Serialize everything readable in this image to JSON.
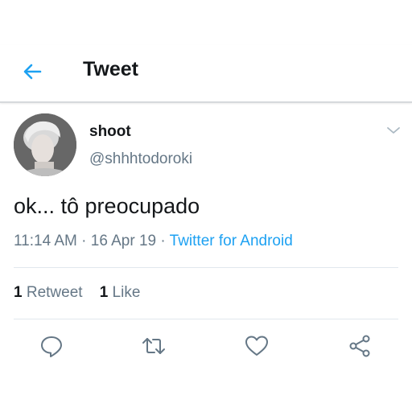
{
  "header": {
    "back_icon": "back-arrow-icon",
    "title": "Tweet"
  },
  "tweet": {
    "author": {
      "display_name": "shoot",
      "handle": "@shhhtodoroki"
    },
    "text": "ok... tô preocupado",
    "time": "11:14 AM",
    "separator": " · ",
    "date": "16 Apr 19",
    "source": "Twitter for Android"
  },
  "stats": {
    "retweets_count": "1",
    "retweets_label": "Retweet",
    "likes_count": "1",
    "likes_label": "Like"
  },
  "actions": {
    "reply_icon": "reply-icon",
    "retweet_icon": "retweet-icon",
    "like_icon": "heart-icon",
    "share_icon": "share-icon"
  },
  "colors": {
    "accent": "#1da1f2",
    "text": "#14171a",
    "secondary": "#657786",
    "divider": "#e1e8ed"
  }
}
